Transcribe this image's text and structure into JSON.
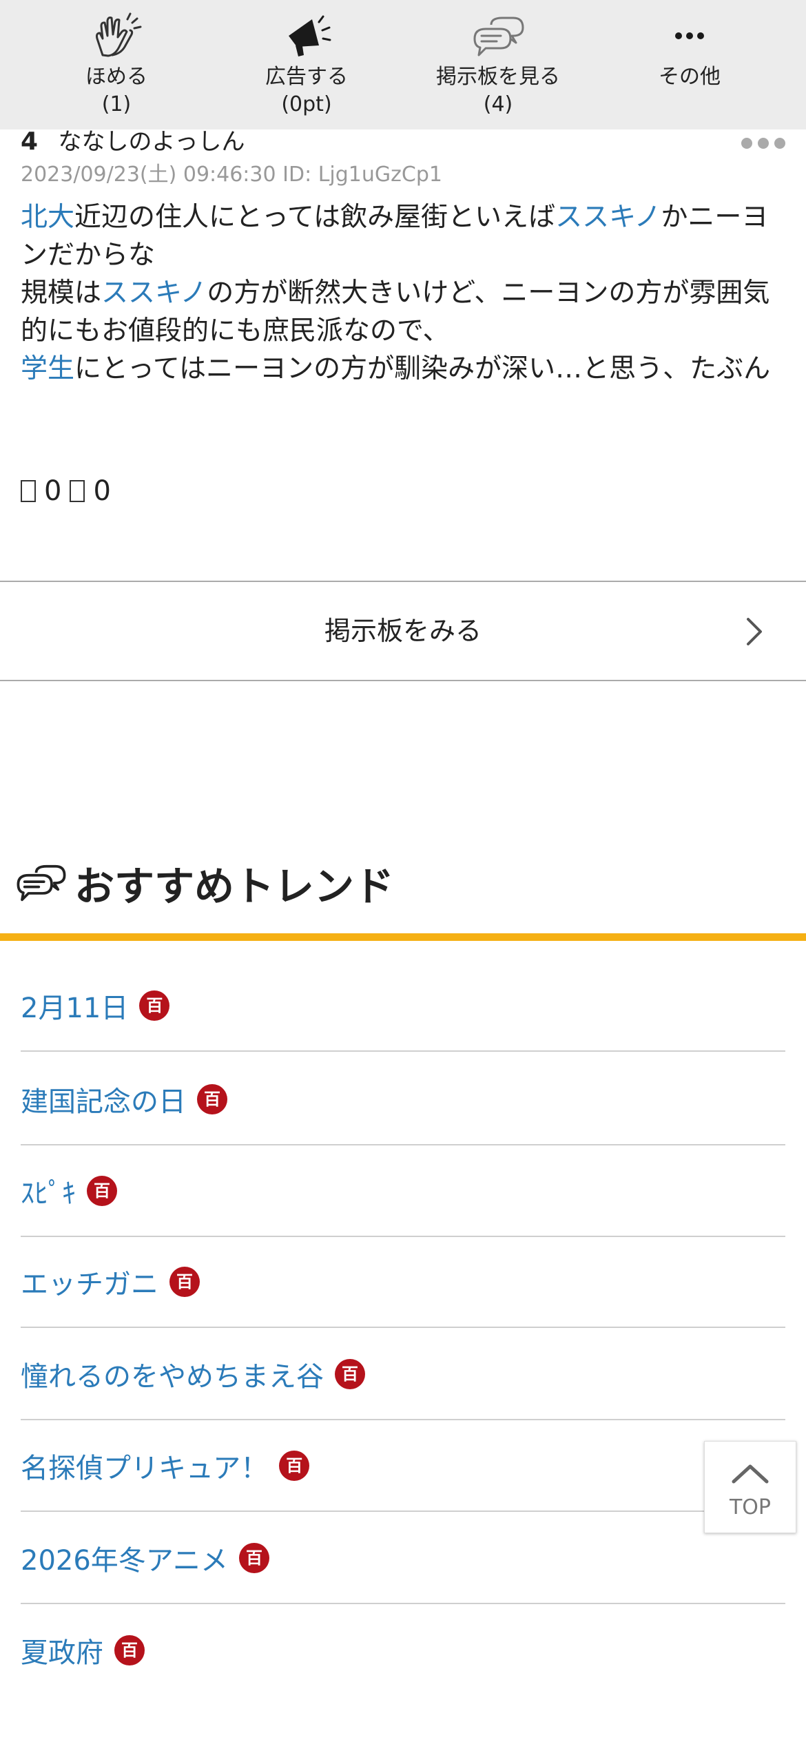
{
  "action_bar": {
    "praise": {
      "label": "ほめる",
      "count": "(1)",
      "icon": "clapping-hands-icon"
    },
    "advertise": {
      "label": "広告する",
      "count": "(0pt)",
      "icon": "megaphone-icon"
    },
    "view_board": {
      "label": "掲示板を見る",
      "count": "(4)",
      "icon": "speech-bubbles-icon"
    },
    "other": {
      "label": "その他",
      "icon": "ellipsis-icon"
    }
  },
  "post": {
    "number": "4",
    "name": "ななしのよっしん",
    "meta": "2023/09/23(土) 09:46:30 ID: Ljg1uGzCp1",
    "body": {
      "l1a": "北大",
      "l1b": "近辺の住人にとっては飲み屋街といえば",
      "l1c": "ススキノ",
      "l1d": "かニーヨンだからな",
      "l2a": "規模は",
      "l2b": "ススキノ",
      "l2c": "の方が断然大きいけど、ニーヨンの方が雰囲気的にもお値段的にも庶民派なので、",
      "l3a": "学生",
      "l3b": "にとってはニーヨンの方が馴染みが深い…と思う、たぶん"
    },
    "votes": {
      "good": "0",
      "bad": "0"
    }
  },
  "board_button": {
    "label": "掲示板をみる"
  },
  "trends": {
    "title": "おすすめトレンド",
    "badge": "百",
    "items": [
      "2月11日",
      "建国記念の日",
      "ｽﾋﾟｷ",
      "エッチガニ",
      "憧れるのをやめちまえ谷",
      "名探偵プリキュア！",
      "2026年冬アニメ",
      "夏政府"
    ]
  },
  "top_button": {
    "label": "TOP"
  },
  "colors": {
    "link": "#2b7bb9",
    "accent": "#f5b014",
    "badge": "#b5121b",
    "bar_bg": "#ececec"
  }
}
